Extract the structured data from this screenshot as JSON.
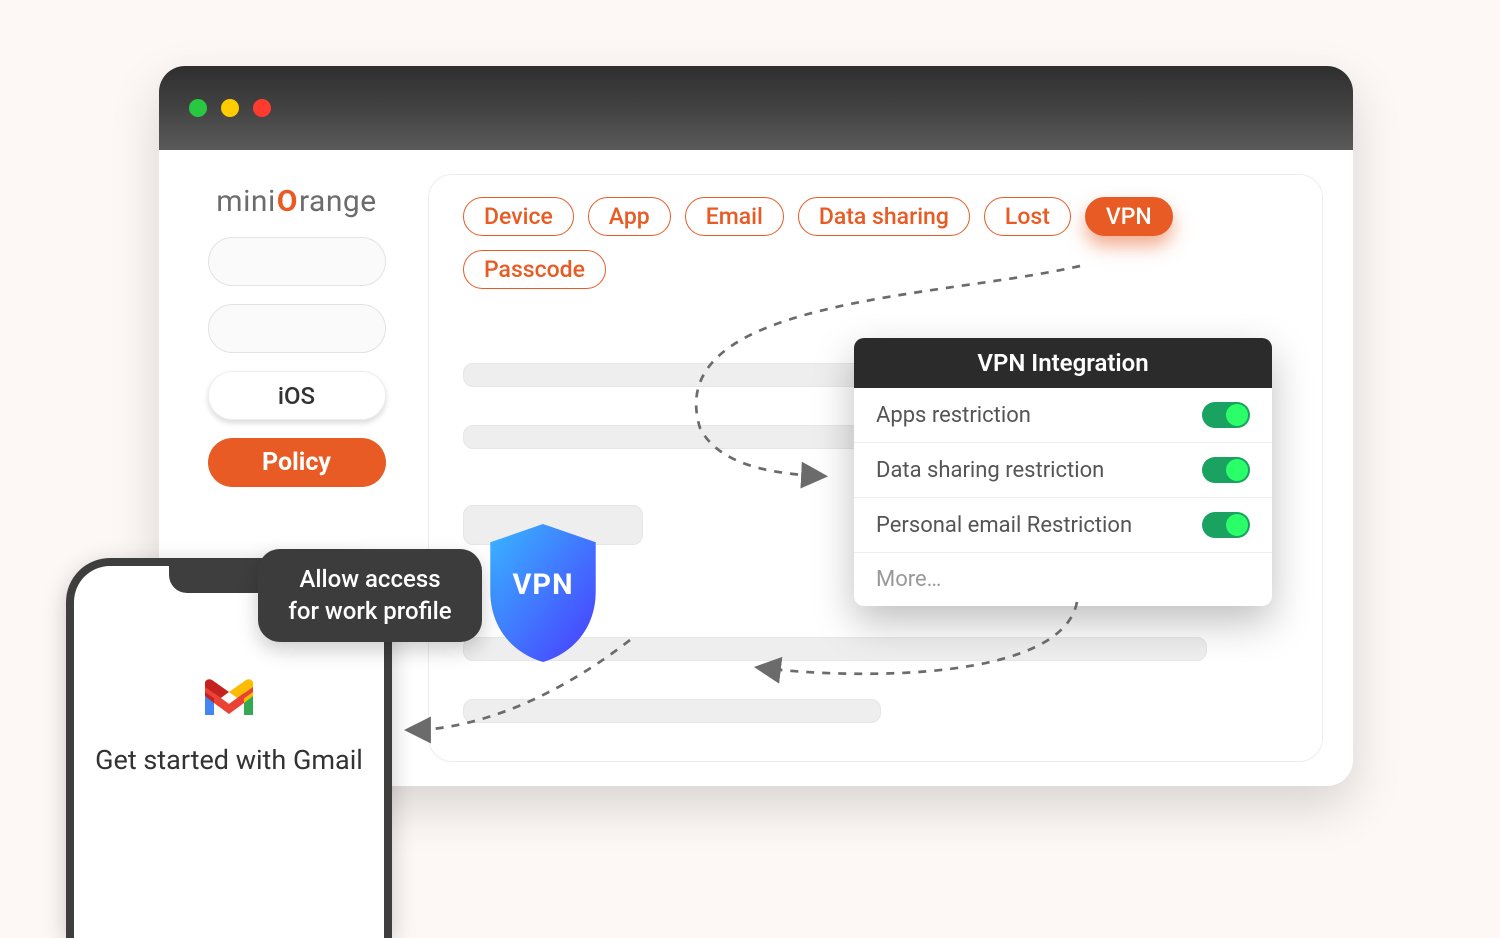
{
  "brand": {
    "part1": "mini",
    "part2": "O",
    "part3": "range"
  },
  "sidebar": {
    "items": [
      {
        "label": ""
      },
      {
        "label": ""
      },
      {
        "label": "iOS"
      },
      {
        "label": "Policy"
      }
    ]
  },
  "tabs": [
    {
      "label": "Device",
      "active": false
    },
    {
      "label": "App",
      "active": false
    },
    {
      "label": "Email",
      "active": false
    },
    {
      "label": "Data sharing",
      "active": false
    },
    {
      "label": "Lost",
      "active": false
    },
    {
      "label": "VPN",
      "active": true
    },
    {
      "label": "Passcode",
      "active": false
    }
  ],
  "vpn_badge_label": "VPN",
  "popup": {
    "title": "VPN Integration",
    "rows": [
      {
        "label": "Apps restriction",
        "on": true
      },
      {
        "label": "Data sharing restriction",
        "on": true
      },
      {
        "label": "Personal email Restriction",
        "on": true
      }
    ],
    "more_label": "More…"
  },
  "callout_text": "Allow access for work profile",
  "phone": {
    "caption": "Get started with Gmail"
  },
  "icons": {
    "traffic_green": "circle",
    "traffic_yellow": "circle",
    "traffic_red": "circle",
    "gmail": "gmail-icon",
    "shield": "shield-icon"
  }
}
